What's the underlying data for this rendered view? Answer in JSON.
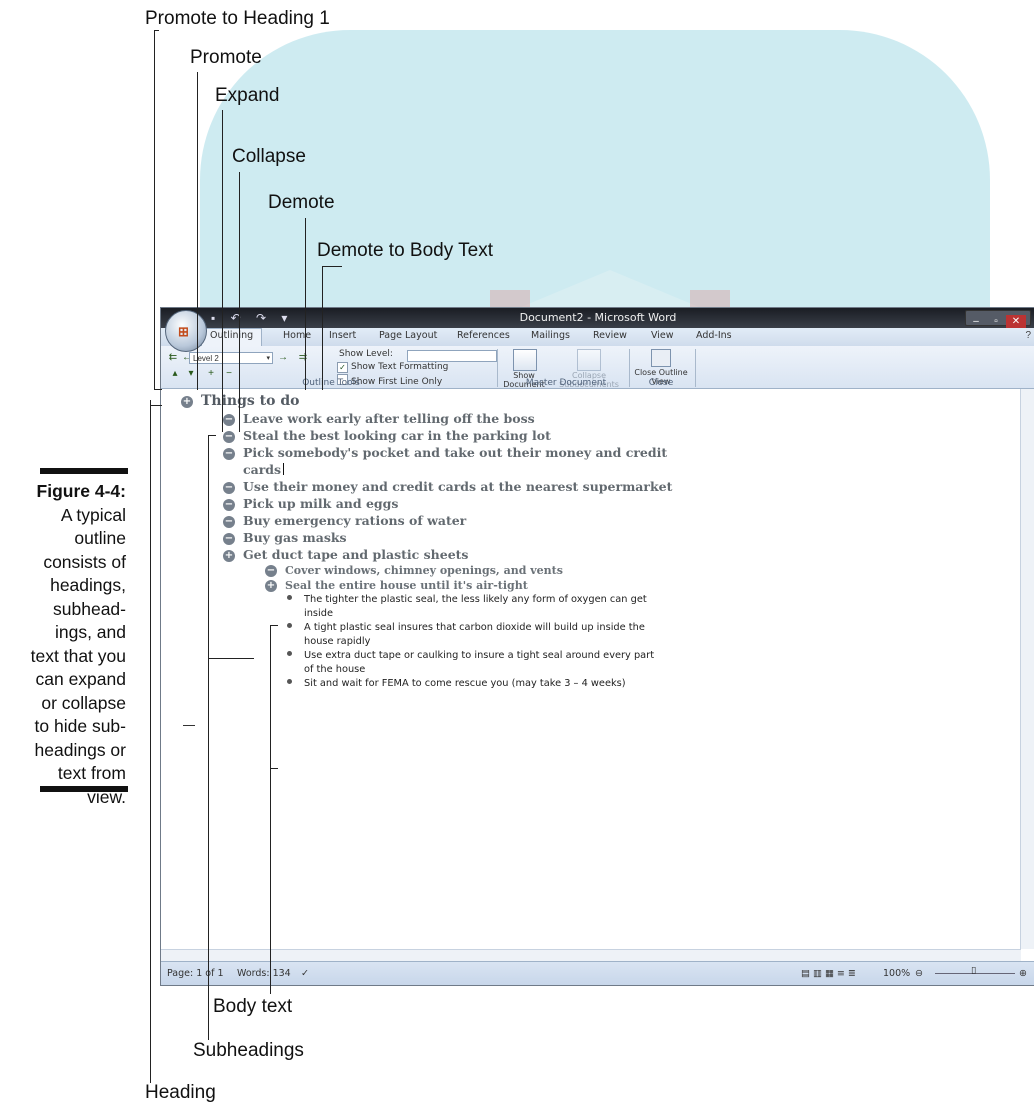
{
  "callouts": {
    "promote_heading1": "Promote to Heading 1",
    "promote": "Promote",
    "expand": "Expand",
    "collapse": "Collapse",
    "demote": "Demote",
    "demote_body": "Demote to Body Text",
    "body_text": "Body text",
    "subheadings": "Subheadings",
    "heading": "Heading"
  },
  "caption": {
    "label": "Figure 4-4:",
    "lines": [
      "A typical",
      "outline",
      "consists of",
      "headings,",
      "subhead-",
      "ings, and",
      "text that you",
      "can expand",
      "or collapse",
      "to hide sub-",
      "headings or",
      "text from",
      "view."
    ]
  },
  "window": {
    "title": "Document2 - Microsoft Word",
    "tabs": [
      "Outlining",
      "Home",
      "Insert",
      "Page Layout",
      "References",
      "Mailings",
      "Review",
      "View",
      "Add-Ins"
    ],
    "level_value": "Level 2",
    "show_level_label": "Show Level:",
    "show_text_formatting": "Show Text Formatting",
    "show_first_line": "Show First Line Only",
    "group_outline_tools": "Outline Tools",
    "show_document": "Show Document",
    "collapse_subdocuments": "Collapse Subdocuments",
    "group_master_document": "Master Document",
    "close_outline": "Close Outline View",
    "group_close": "Close"
  },
  "outline": {
    "heading": "Things to do",
    "subheadings": [
      "Leave work early after telling off the boss",
      "Steal the best looking car in the parking lot",
      "Pick somebody's pocket and take out their money and credit",
      "cards",
      "Use their money and credit cards at the nearest supermarket",
      "Pick up milk and eggs",
      "Buy emergency rations of water",
      "Buy gas masks",
      "Get duct tape and plastic sheets"
    ],
    "subsub": [
      "Cover windows, chimney openings, and vents",
      "Seal the entire house until it's air-tight"
    ],
    "body": [
      "The tighter the plastic seal, the less likely any form of oxygen can get",
      "inside",
      "A tight plastic seal insures that carbon dioxide will build up inside the",
      "house rapidly",
      "Use extra duct tape or caulking to insure a tight seal around every part",
      "of the house",
      "Sit and wait for FEMA to come rescue you (may take 3 – 4 weeks)"
    ]
  },
  "status": {
    "page": "Page: 1 of 1",
    "words": "Words: 134",
    "zoom": "100%"
  }
}
